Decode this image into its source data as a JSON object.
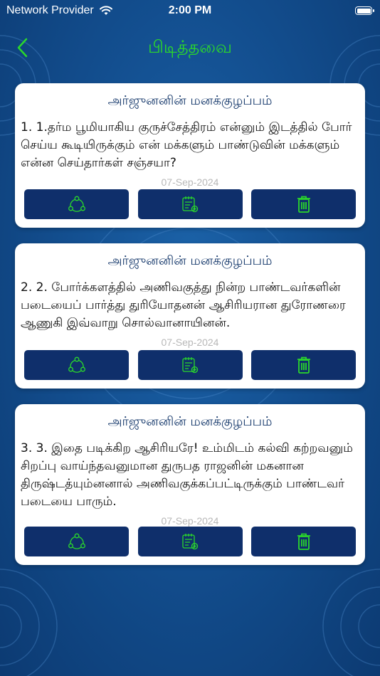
{
  "status": {
    "carrier": "Network Provider",
    "time": "2:00 PM"
  },
  "header": {
    "title": "பிடித்தவை"
  },
  "colors": {
    "accent_green": "#2bd82b",
    "button_bg": "#0f2f6b",
    "card_title": "#15386b",
    "date_gray": "#b8b8b8"
  },
  "cards": [
    {
      "title": "அர்ஜுனனின் மனக்குழப்பம்",
      "text": "1. 1.தர்ம பூமியாகிய குருச்சேத்திரம் என்னும் இடத்தில் போர் செய்ய கூடியிருக்கும் என் மக்களும் பாண்டுவின் மக்களும் என்ன செய்தார்கள் சஞ்சயா?",
      "date": "07-Sep-2024"
    },
    {
      "title": "அர்ஜுனனின் மனக்குழப்பம்",
      "text": "2. 2. போர்க்களத்தில் அணிவகுத்து நின்ற பாண்டவர்களின் படையைப் பார்த்து துரியோதனன் ஆசிரியரான துரோணரை ஆணுகி இவ்வாறு சொல்வானாயினன்.",
      "date": "07-Sep-2024"
    },
    {
      "title": "அர்ஜுனனின் மனக்குழப்பம்",
      "text": "3. 3. இதை படிக்கிற  ஆசிரியரே! உம்மிடம் கல்வி கற்றவனும் சிறப்பு வாய்ந்தவனுமான துருபத ராஜனின் மகனான திருஷ்டத்யும்னனால் அணிவகுக்கப்பட்டிருக்கும் பாண்டவர் படையை  பாரும்.",
      "date": "07-Sep-2024"
    }
  ],
  "icons": {
    "back": "chevron-left-icon",
    "share": "share-icon",
    "note": "note-add-icon",
    "delete": "trash-icon"
  }
}
